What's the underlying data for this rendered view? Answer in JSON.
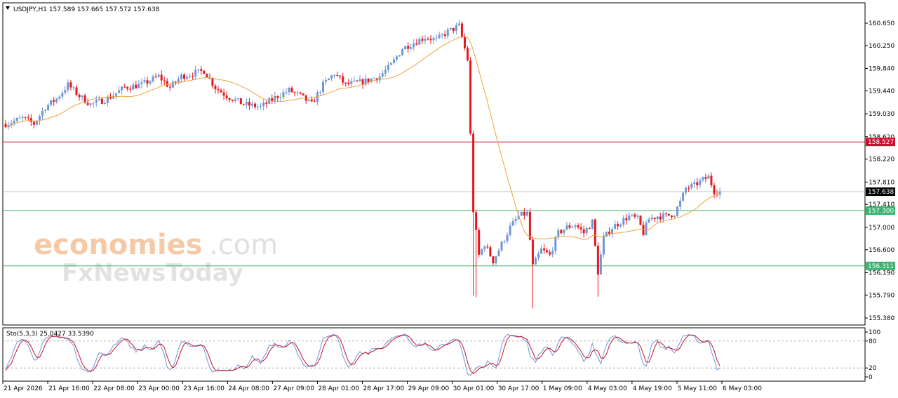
{
  "header": {
    "symbol_line": "USDJPY,H1  157.589 157.665 157.572 157.638"
  },
  "watermark": {
    "brand_colored": "economies",
    "brand_suffix": ".com",
    "brand_second": "FxNewsToday"
  },
  "price_panel": {
    "y_ticks": [
      "160.650",
      "160.250",
      "159.840",
      "159.440",
      "159.030",
      "158.620",
      "158.220",
      "157.810",
      "157.410",
      "157.000",
      "156.600",
      "156.190",
      "155.790",
      "155.380"
    ],
    "ylim": [
      155.38,
      160.8
    ],
    "lines": [
      {
        "value": 158.527,
        "label": "158.527",
        "color": "#c8102e"
      },
      {
        "value": 157.638,
        "label": "157.638",
        "color": "#000000",
        "line_color": "#c0c0c0"
      },
      {
        "value": 157.3,
        "label": "157.300",
        "color": "#3cb371"
      },
      {
        "value": 156.311,
        "label": "156.311",
        "color": "#3cb371"
      }
    ]
  },
  "stoch_panel": {
    "label": "Sto(5,3,3) 25.0427 33.5390",
    "y_ticks": [
      "100",
      "80",
      "20",
      "0"
    ],
    "levels": [
      80,
      20
    ]
  },
  "x_axis": {
    "labels": [
      "21 Apr 2026",
      "21 Apr 16:00",
      "22 Apr 08:00",
      "23 Apr 00:00",
      "23 Apr 16:00",
      "24 Apr 08:00",
      "27 Apr 09:00",
      "28 Apr 01:00",
      "28 Apr 17:00",
      "29 Apr 09:00",
      "30 Apr 01:00",
      "30 Apr 17:00",
      "1 May 09:00",
      "4 May 03:00",
      "4 May 19:00",
      "5 May 11:00",
      "6 May 03:00"
    ]
  },
  "chart_data": {
    "type": "candlestick",
    "symbol": "USDJPY",
    "timeframe": "H1",
    "ohlc_last": {
      "open": 157.589,
      "high": 157.665,
      "low": 157.572,
      "close": 157.638
    },
    "up_color": "#6f97d6",
    "down_color": "#e8161e",
    "ma_color": "#f0a23c",
    "stoch_main_color": "#6f97d6",
    "stoch_signal_color": "#c8102e",
    "anchors": [
      [
        0,
        158.85
      ],
      [
        6,
        158.95
      ],
      [
        10,
        158.85
      ],
      [
        14,
        159.15
      ],
      [
        18,
        159.3
      ],
      [
        22,
        159.55
      ],
      [
        26,
        159.35
      ],
      [
        30,
        159.2
      ],
      [
        36,
        159.3
      ],
      [
        42,
        159.5
      ],
      [
        48,
        159.55
      ],
      [
        54,
        159.7
      ],
      [
        58,
        159.5
      ],
      [
        62,
        159.7
      ],
      [
        66,
        159.75
      ],
      [
        70,
        159.8
      ],
      [
        74,
        159.5
      ],
      [
        78,
        159.35
      ],
      [
        84,
        159.2
      ],
      [
        90,
        159.15
      ],
      [
        96,
        159.35
      ],
      [
        100,
        159.45
      ],
      [
        104,
        159.35
      ],
      [
        108,
        159.2
      ],
      [
        112,
        159.55
      ],
      [
        116,
        159.75
      ],
      [
        120,
        159.55
      ],
      [
        126,
        159.6
      ],
      [
        132,
        159.7
      ],
      [
        136,
        159.9
      ],
      [
        140,
        160.2
      ],
      [
        144,
        160.3
      ],
      [
        148,
        160.4
      ],
      [
        152,
        160.35
      ],
      [
        156,
        160.5
      ],
      [
        160,
        160.6
      ],
      [
        163,
        160.0
      ],
      [
        165,
        157.3
      ],
      [
        167,
        156.5
      ],
      [
        169,
        156.7
      ],
      [
        172,
        156.4
      ],
      [
        175,
        156.7
      ],
      [
        178,
        157.0
      ],
      [
        181,
        157.2
      ],
      [
        184,
        157.25
      ],
      [
        186,
        156.3
      ],
      [
        189,
        156.6
      ],
      [
        192,
        156.5
      ],
      [
        195,
        156.9
      ],
      [
        198,
        157.0
      ],
      [
        201,
        157.05
      ],
      [
        204,
        156.9
      ],
      [
        207,
        157.1
      ],
      [
        209,
        156.2
      ],
      [
        211,
        156.8
      ],
      [
        214,
        157.0
      ],
      [
        217,
        157.1
      ],
      [
        220,
        157.2
      ],
      [
        223,
        157.15
      ],
      [
        225,
        156.9
      ],
      [
        227,
        157.15
      ],
      [
        230,
        157.2
      ],
      [
        233,
        157.2
      ],
      [
        236,
        157.25
      ],
      [
        238,
        157.45
      ],
      [
        240,
        157.7
      ],
      [
        243,
        157.75
      ],
      [
        246,
        157.85
      ],
      [
        248,
        157.9
      ],
      [
        250,
        157.65
      ],
      [
        252,
        157.64
      ]
    ]
  }
}
